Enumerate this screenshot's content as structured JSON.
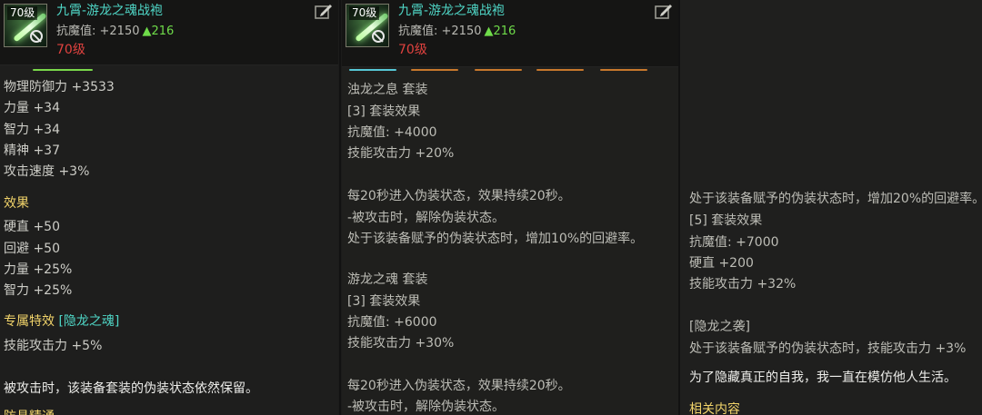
{
  "item": {
    "level_badge": "70级",
    "name": "九霄-游龙之魂战袍",
    "resist_label": "抗魔值: +2150",
    "resist_delta": "▲216",
    "level_req": "70级"
  },
  "panel1": {
    "lines": [
      "物理防御力 +3533",
      "力量 +34",
      "智力 +34",
      "精神 +37",
      "攻击速度 +3%",
      "效果",
      "硬直 +50",
      "回避 +50",
      "力量 +25%",
      "智力 +25%",
      "专属特效",
      "[隐龙之魂]",
      "技能攻击力 +5%",
      "被攻击时，该装备套装的伪装状态依然保留。",
      "防具精通"
    ]
  },
  "panel2": {
    "lines": [
      "浊龙之息  套装",
      "[3] 套装效果",
      "抗魔值: +4000",
      "技能攻击力 +20%",
      "每20秒进入伪装状态，效果持续20秒。",
      "-被攻击时，解除伪装状态。",
      "处于该装备赋予的伪装状态时，增加10%的回避率。",
      "游龙之魂  套装",
      "[3] 套装效果",
      "抗魔值: +6000",
      "技能攻击力 +30%",
      "每20秒进入伪装状态，效果持续20秒。",
      "-被攻击时，解除伪装状态。"
    ]
  },
  "panel3": {
    "lines": [
      "处于该装备赋予的伪装状态时，增加20%的回避率。",
      "[5] 套装效果",
      "抗魔值: +7000",
      "硬直 +200",
      "技能攻击力 +32%",
      "[隐龙之袭]",
      "处于该装备赋予的伪装状态时，技能攻击力 +3%",
      "为了隐藏真正的自我，我一直在模仿他人生活。",
      "相关内容"
    ]
  },
  "colors": {
    "item_name": "#4fd6c6",
    "level_req": "#e0423f",
    "delta_up": "#6fdc4a",
    "section_header": "#f2d46a",
    "tab_active_green": "#7ad84a",
    "tab_active_cyan": "#57c8d6",
    "tab_inactive": "#c8782c"
  },
  "icons": {
    "item_icon": "jade-blade-icon",
    "edit_icon": "compare-edit-icon"
  }
}
